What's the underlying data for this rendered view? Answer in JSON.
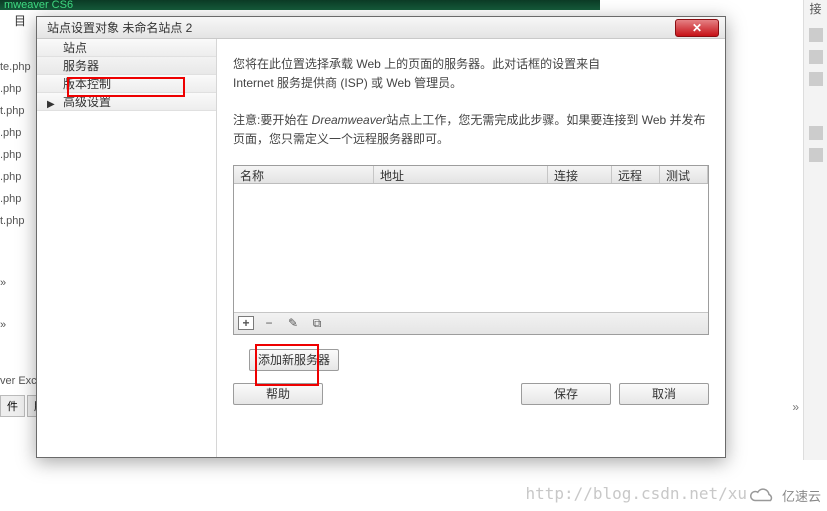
{
  "bg": {
    "app_title": "mweaver CS6",
    "sidebar_label": "目",
    "files": [
      "te.php",
      ".php",
      "t.php",
      ".php",
      ".php",
      ".php",
      ".php",
      "t.php"
    ],
    "more1": "»",
    "more2": "»",
    "exchange": "ver Exch",
    "tab1": "件",
    "tab2": "服"
  },
  "dialog": {
    "title": "站点设置对象 未命名站点 2",
    "close": "✕",
    "nav": {
      "site": "站点",
      "server": "服务器",
      "version": "版本控制",
      "advanced": "高级设置"
    },
    "desc": "您将在此位置选择承载 Web 上的页面的服务器。此对话框的设置来自\nInternet 服务提供商 (ISP) 或 Web 管理员。",
    "note_prefix": "注意:要开始在 ",
    "note_dw": "Dreamweaver",
    "note_suffix": "站点上工作，您无需完成此步骤。如果要连接到 Web 并发布页面，您只需定义一个远程服务器即可。",
    "table": {
      "name": "名称",
      "addr": "地址",
      "conn": "连接",
      "remote": "远程",
      "test": "测试"
    },
    "toolbar": {
      "plus": "+",
      "minus": "−",
      "edit": "✎",
      "dup": "⧉"
    },
    "add_server": "添加新服务器",
    "help": "帮助",
    "save": "保存",
    "cancel": "取消"
  },
  "watermark": "http://blog.csdn.net/xu",
  "cloud_brand": "亿速云",
  "dbl_chevron": "»",
  "right_char": "接"
}
